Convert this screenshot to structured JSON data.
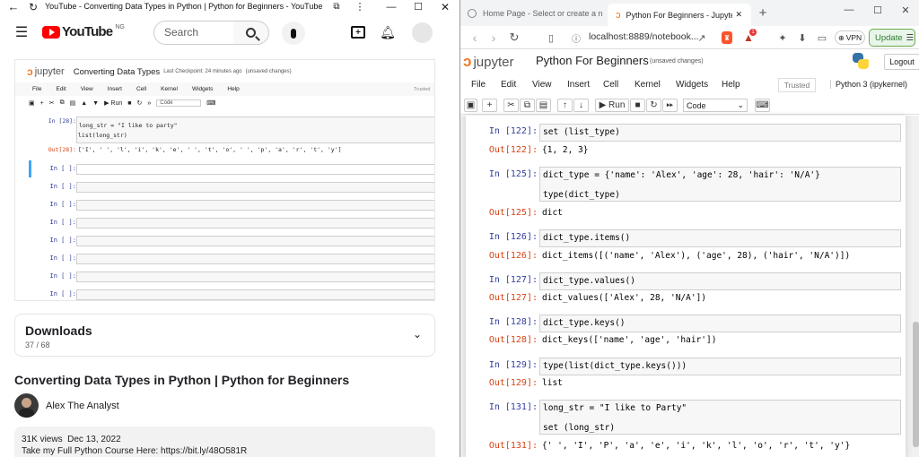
{
  "left": {
    "window_title": "YouTube - Converting Data Types in Python | Python for Beginners - YouTube",
    "youtube": {
      "brand": "YouTube",
      "region": "NG",
      "search_placeholder": "Search"
    },
    "notebook": {
      "logo": "jupyter",
      "title": "Converting Data Types",
      "checkpoint": "Last Checkpoint: 24 minutes ago",
      "unsaved": "(unsaved changes)",
      "menu": [
        "File",
        "Edit",
        "View",
        "Insert",
        "Cell",
        "Kernel",
        "Widgets",
        "Help"
      ],
      "trusted": "Trusted",
      "run": "Run",
      "celltype": "Code",
      "cell28_prompt_in": "In [28]:",
      "cell28_line1": "long_str = \"I like to party\"",
      "cell28_line2": "list(long_str)",
      "cell28_prompt_out": "Out[28]:",
      "cell28_output": "['I', ' ', 'l', 'i', 'k', 'e', ' ', 't', 'o', ' ', 'p', 'a', 'r', 't', 'y']",
      "empty_prompt": "In [ ]:"
    },
    "downloads": {
      "title": "Downloads",
      "count": "37 / 68"
    },
    "video_title": "Converting Data Types in Python | Python for Beginners",
    "channel": "Alex The Analyst",
    "views": "31K views",
    "date": "Dec 13, 2022",
    "desc_line": "Take my Full Python Course Here: https://bit.ly/48O581R"
  },
  "right": {
    "tabs": [
      {
        "label": "Home Page - Select or create a note"
      },
      {
        "label": "Python For Beginners - Jupyter"
      }
    ],
    "url": "localhost:8889/notebook...",
    "vpn": "VPN",
    "update": "Update",
    "shield_badge": "1",
    "notebook": {
      "logo": "jupyter",
      "title": "Python For Beginners",
      "unsaved": "(unsaved changes)",
      "logout": "Logout",
      "menu": [
        "File",
        "Edit",
        "View",
        "Insert",
        "Cell",
        "Kernel",
        "Widgets",
        "Help"
      ],
      "trusted": "Trusted",
      "kernel": "Python 3 (ipykernel)",
      "run": "Run",
      "celltype": "Code"
    },
    "cells": [
      {
        "in": "In [122]:",
        "code": [
          "set (list_type)"
        ],
        "out": "Out[122]:",
        "output": "{1, 2, 3}"
      },
      {
        "in": "In [125]:",
        "code": [
          "dict_type = {'name': 'Alex', 'age': 28, 'hair': 'N/A'}",
          "type(dict_type)"
        ],
        "out": "Out[125]:",
        "output": "dict"
      },
      {
        "in": "In [126]:",
        "code": [
          "dict_type.items()"
        ],
        "out": "Out[126]:",
        "output": "dict_items([('name', 'Alex'), ('age', 28), ('hair', 'N/A')])"
      },
      {
        "in": "In [127]:",
        "code": [
          "dict_type.values()"
        ],
        "out": "Out[127]:",
        "output": "dict_values(['Alex', 28, 'N/A'])"
      },
      {
        "in": "In [128]:",
        "code": [
          "dict_type.keys()"
        ],
        "out": "Out[128]:",
        "output": "dict_keys(['name', 'age', 'hair'])"
      },
      {
        "in": "In [129]:",
        "code": [
          "type(list(dict_type.keys()))"
        ],
        "out": "Out[129]:",
        "output": "list"
      },
      {
        "in": "In [131]:",
        "code": [
          "long_str = \"I like to Party\"",
          "set (long_str)"
        ],
        "out": "Out[131]:",
        "output": "{' ', 'I', 'P', 'a', 'e', 'i', 'k', 'l', 'o', 'r', 't', 'y'}"
      }
    ]
  },
  "colors": {
    "youtube_red": "#ff0000",
    "jupyter_orange": "#f37626",
    "prompt_in": "#303f9f",
    "prompt_out": "#d84315",
    "selected_cell": "#42a5f5"
  }
}
